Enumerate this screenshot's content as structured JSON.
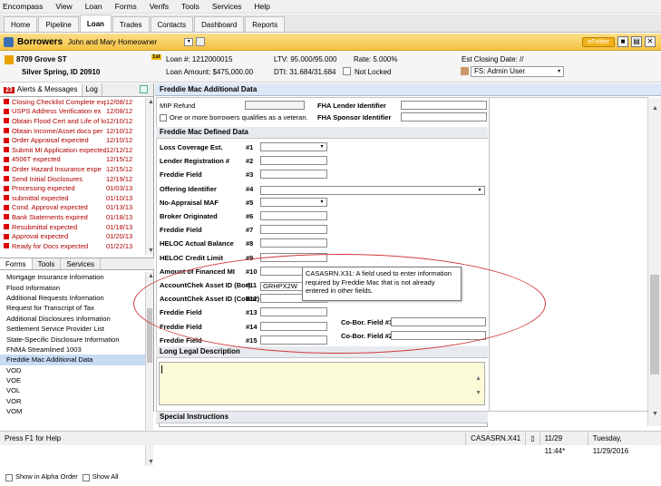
{
  "menu": [
    "Encompass",
    "View",
    "Loan",
    "Forms",
    "Verifs",
    "Tools",
    "Services",
    "Help"
  ],
  "tabs": [
    "Home",
    "Pipeline",
    "Loan",
    "Trades",
    "Contacts",
    "Dashboard",
    "Reports"
  ],
  "borrowers": {
    "title": "Borrowers",
    "name": "John and Mary Homeowner",
    "efolder": "eFolder"
  },
  "loan": {
    "address1": "8709 Grove ST",
    "address2": "Silver Spring, ID 20910",
    "loan_num": "Loan #: 1212000015",
    "loan_amount": "Loan Amount: $475,000.00",
    "ltv": "LTV: 95.000/95.000",
    "dti": "DTI: 31.684/31.684",
    "rate": "Rate: 5.000%",
    "lock": "Not Locked",
    "closing": "Est Closing Date: //",
    "user": "FS: Admin User"
  },
  "alerts": {
    "count": "23",
    "tab1": "Alerts & Messages",
    "tab2": "Log",
    "items": [
      {
        "msg": "Closing Checklist Complete exp",
        "date": "12/08/12"
      },
      {
        "msg": "USPS Address Verification ex",
        "date": "12/08/12"
      },
      {
        "msg": "Obtain Flood Cert and Life of lo",
        "date": "12/10/12"
      },
      {
        "msg": "Obtain Income/Asset docs per",
        "date": "12/10/12"
      },
      {
        "msg": "Order Appraisal expected",
        "date": "12/10/12"
      },
      {
        "msg": "Submit MI Application expected",
        "date": "12/12/12"
      },
      {
        "msg": "4506T expected",
        "date": "12/15/12"
      },
      {
        "msg": "Order Hazard Insurance expe",
        "date": "12/15/12"
      },
      {
        "msg": "Send Initial Disclosures",
        "date": "12/19/12"
      },
      {
        "msg": "Processing expected",
        "date": "01/03/13"
      },
      {
        "msg": "submittal expected",
        "date": "01/10/13"
      },
      {
        "msg": "Cond. Approval expected",
        "date": "01/13/13"
      },
      {
        "msg": "Bank Statements expired",
        "date": "01/18/13"
      },
      {
        "msg": "Resubmittal expected",
        "date": "01/18/13"
      },
      {
        "msg": "Approval expected",
        "date": "01/20/13"
      },
      {
        "msg": "Ready for Docs expected",
        "date": "01/22/13"
      }
    ]
  },
  "forms_tabs": [
    "Forms",
    "Tools",
    "Services"
  ],
  "forms": [
    "Mortgage Insurance Information",
    "Flood Information",
    "Additional Requests Information",
    "Request for Transcript of Tax",
    "Additional Disclosures Information",
    "Settlement Service Provider List",
    "State-Specific Disclosure Information",
    "FNMA Streamlined 1003",
    "Freddie Mac Additional Data",
    "VOD",
    "VOE",
    "VOL",
    "VOR",
    "VOM"
  ],
  "checks": {
    "alpha": "Show in Alpha Order",
    "all": "Show All"
  },
  "main": {
    "header": "Freddie Mac Additional Data",
    "mip": "MIP Refund",
    "veteran": "One or more borrowers qualifies as a veteran.",
    "fha_lender": "FHA Lender Identifier",
    "fha_sponsor": "FHA Sponsor Identifier",
    "section1": "Freddie Mac Defined Data",
    "fields": [
      {
        "label": "Loss Coverage Est.",
        "num": "#1"
      },
      {
        "label": "Lender Registration #",
        "num": "#2"
      },
      {
        "label": "Freddie Field",
        "num": "#3"
      },
      {
        "label": "Offering Identifier",
        "num": "#4"
      },
      {
        "label": "No-Appraisal MAF",
        "num": "#5"
      },
      {
        "label": "Broker Originated",
        "num": "#6"
      },
      {
        "label": "Freddie Field",
        "num": "#7"
      },
      {
        "label": "HELOC Actual Balance",
        "num": "#8"
      },
      {
        "label": "HELOC Credit Limit",
        "num": "#9"
      },
      {
        "label": "Amount of Financed MI",
        "num": "#10"
      },
      {
        "label": "AccountChek Asset ID (Bor)",
        "num": "#11"
      },
      {
        "label": "AccountChek Asset ID (CoBor)",
        "num": "#12"
      },
      {
        "label": "Freddie Field",
        "num": "#13"
      },
      {
        "label": "Freddie Field",
        "num": "#14"
      },
      {
        "label": "Freddie Field",
        "num": "#15"
      }
    ],
    "asset_value": "GRHPX2W",
    "cobor1": "Co-Bor. Field #1",
    "cobor2": "Co-Bor. Field #2",
    "section2": "Long Legal Description",
    "section3": "Special Instructions",
    "tooltip": "CASASRN.X31: A field used to enter information required by Freddie Mac that is not already entered in other fields."
  },
  "status": {
    "help": "Press F1 for Help",
    "field": "CASASRN.X41",
    "time": "11/29 11:44*",
    "date": "Tuesday, 11/29/2016"
  }
}
